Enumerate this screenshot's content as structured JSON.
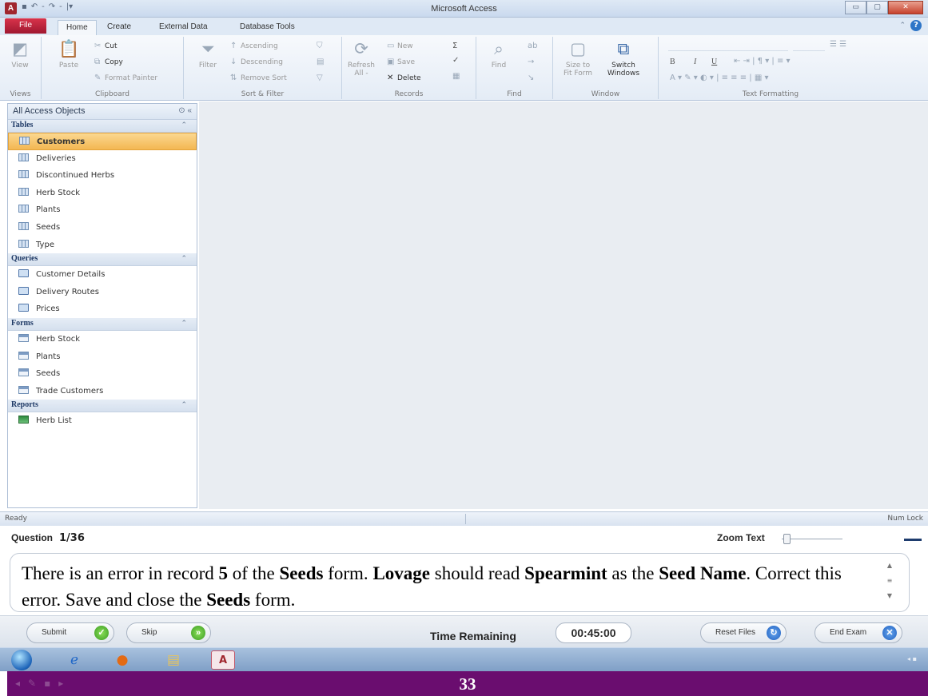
{
  "window": {
    "title": "Microsoft Access",
    "app_icon": "A",
    "qat": [
      "▪",
      "↶",
      "-",
      "↷",
      "-",
      "|▾"
    ],
    "min": "▭",
    "max": "▢",
    "close": "✕"
  },
  "tabs": {
    "file": "File",
    "home": "Home",
    "create": "Create",
    "external": "External Data",
    "dbtools": "Database Tools",
    "help": "?"
  },
  "ribbon": {
    "views": {
      "view": "View",
      "label": "Views"
    },
    "clipboard": {
      "paste": "Paste",
      "cut": "Cut",
      "copy": "Copy",
      "format_painter": "Format Painter",
      "label": "Clipboard"
    },
    "sort_filter": {
      "filter": "Filter",
      "ascending": "Ascending",
      "descending": "Descending",
      "remove_sort": "Remove Sort",
      "label": "Sort & Filter"
    },
    "records": {
      "refresh_1": "Refresh",
      "refresh_2": "All -",
      "new": "New",
      "save": "Save",
      "delete": "Delete",
      "label": "Records"
    },
    "find": {
      "find": "Find",
      "label": "Find"
    },
    "window": {
      "size_1": "Size to",
      "size_2": "Fit Form",
      "switch_1": "Switch",
      "switch_2": "Windows",
      "label": "Window"
    },
    "text_formatting": {
      "label": "Text Formatting",
      "bold": "B",
      "italic": "I",
      "underline": "U"
    }
  },
  "nav": {
    "header": "All Access Objects",
    "sections": {
      "tables": {
        "title": "Tables",
        "items": [
          {
            "label": "Customers"
          },
          {
            "label": "Deliveries"
          },
          {
            "label": "Discontinued Herbs"
          },
          {
            "label": "Herb Stock"
          },
          {
            "label": "Plants"
          },
          {
            "label": "Seeds"
          },
          {
            "label": "Type"
          }
        ]
      },
      "queries": {
        "title": "Queries",
        "items": [
          {
            "label": "Customer Details"
          },
          {
            "label": "Delivery Routes"
          },
          {
            "label": "Prices"
          }
        ]
      },
      "forms": {
        "title": "Forms",
        "items": [
          {
            "label": "Herb Stock"
          },
          {
            "label": "Plants"
          },
          {
            "label": "Seeds"
          },
          {
            "label": "Trade Customers"
          }
        ]
      },
      "reports": {
        "title": "Reports",
        "items": [
          {
            "label": "Herb List"
          }
        ]
      }
    },
    "selected": "Customers"
  },
  "status": {
    "left": "Ready",
    "right": "Num Lock"
  },
  "exam": {
    "question_label": "Question",
    "question_count": "1/36",
    "zoom_label": "Zoom Text",
    "zoom_level": 0,
    "question": {
      "p1": "There is an error in record ",
      "b1": "5",
      "p2": " of the ",
      "b2": "Seeds",
      "p3": " form. ",
      "b3": "Lovage",
      "p4": " should read ",
      "b4": "Spearmint",
      "p5": " as the ",
      "b5": "Seed Name",
      "p6": ". Correct this error. Save and close the ",
      "b6": "Seeds",
      "p7": " form."
    },
    "submit": "Submit",
    "skip": "Skip",
    "time_label": "Time Remaining",
    "timer": "00:45:00",
    "reset": "Reset Files",
    "end": "End Exam"
  },
  "slide_number": "33"
}
